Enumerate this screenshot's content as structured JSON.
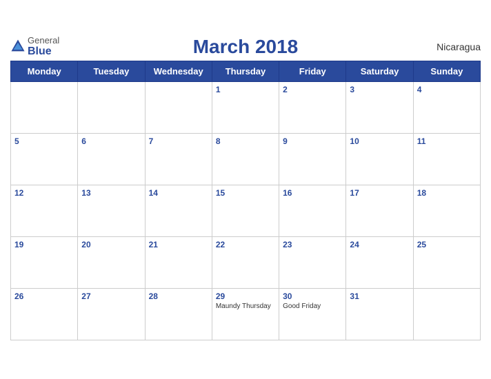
{
  "header": {
    "title": "March 2018",
    "country": "Nicaragua",
    "logo": {
      "general": "General",
      "blue": "Blue"
    }
  },
  "weekdays": [
    "Monday",
    "Tuesday",
    "Wednesday",
    "Thursday",
    "Friday",
    "Saturday",
    "Sunday"
  ],
  "weeks": [
    [
      {
        "day": "",
        "empty": true
      },
      {
        "day": "",
        "empty": true
      },
      {
        "day": "",
        "empty": true
      },
      {
        "day": "1",
        "holiday": ""
      },
      {
        "day": "2",
        "holiday": ""
      },
      {
        "day": "3",
        "holiday": ""
      },
      {
        "day": "4",
        "holiday": ""
      }
    ],
    [
      {
        "day": "5",
        "holiday": ""
      },
      {
        "day": "6",
        "holiday": ""
      },
      {
        "day": "7",
        "holiday": ""
      },
      {
        "day": "8",
        "holiday": ""
      },
      {
        "day": "9",
        "holiday": ""
      },
      {
        "day": "10",
        "holiday": ""
      },
      {
        "day": "11",
        "holiday": ""
      }
    ],
    [
      {
        "day": "12",
        "holiday": ""
      },
      {
        "day": "13",
        "holiday": ""
      },
      {
        "day": "14",
        "holiday": ""
      },
      {
        "day": "15",
        "holiday": ""
      },
      {
        "day": "16",
        "holiday": ""
      },
      {
        "day": "17",
        "holiday": ""
      },
      {
        "day": "18",
        "holiday": ""
      }
    ],
    [
      {
        "day": "19",
        "holiday": ""
      },
      {
        "day": "20",
        "holiday": ""
      },
      {
        "day": "21",
        "holiday": ""
      },
      {
        "day": "22",
        "holiday": ""
      },
      {
        "day": "23",
        "holiday": ""
      },
      {
        "day": "24",
        "holiday": ""
      },
      {
        "day": "25",
        "holiday": ""
      }
    ],
    [
      {
        "day": "26",
        "holiday": ""
      },
      {
        "day": "27",
        "holiday": ""
      },
      {
        "day": "28",
        "holiday": ""
      },
      {
        "day": "29",
        "holiday": "Maundy Thursday"
      },
      {
        "day": "30",
        "holiday": "Good Friday"
      },
      {
        "day": "31",
        "holiday": ""
      },
      {
        "day": "",
        "empty": true
      }
    ]
  ]
}
